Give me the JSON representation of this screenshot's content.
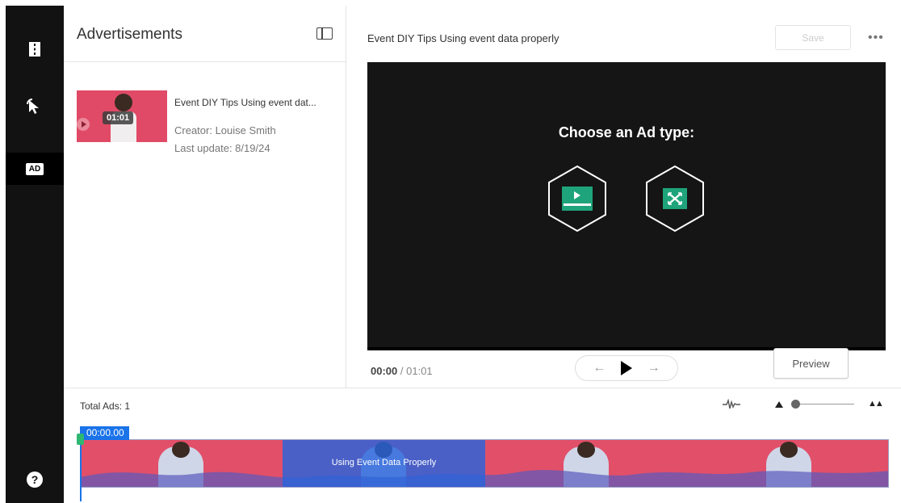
{
  "colors": {
    "rail_bg": "#121212",
    "video_bg": "#151515",
    "accent_blue": "#1a73e8",
    "ad_green": "#1fa37a",
    "thumb_pink": "#e04a66"
  },
  "rail": {
    "items": [
      {
        "icon": "chapters-icon"
      },
      {
        "icon": "cursor-click-icon"
      },
      {
        "icon": "ad-icon",
        "label": "AD",
        "active": true
      }
    ],
    "help_label": "?"
  },
  "panel": {
    "title": "Advertisements",
    "entry": {
      "title": "Event DIY Tips Using event dat...",
      "creator": "Creator: Louise Smith",
      "updated": "Last update: 8/19/24",
      "duration": "01:01"
    }
  },
  "editor": {
    "title": "Event DIY Tips Using event data properly",
    "save_label": "Save",
    "more_label": "•••",
    "choose_label": "Choose an Ad type:",
    "ad_types": [
      {
        "icon": "video-ad-icon"
      },
      {
        "icon": "expand-ad-icon"
      }
    ],
    "time_current": "00:00",
    "time_separator": "/",
    "time_total": "01:01",
    "preview_label": "Preview"
  },
  "timeline": {
    "total_ads": "Total Ads: 1",
    "playhead_time": "00:00.00",
    "ad_segment_label": "Using Event Data Properly",
    "zoom_level": 0.05
  }
}
